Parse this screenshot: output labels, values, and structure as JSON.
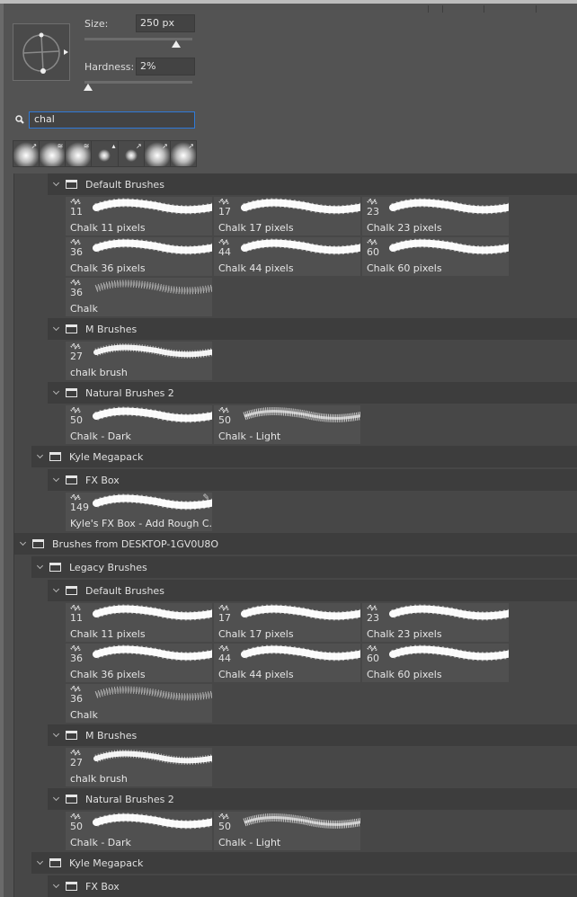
{
  "brush_settings": {
    "size_label": "Size:",
    "size_value": "250 px",
    "size_fraction": 0.85,
    "hardness_label": "Hardness:",
    "hardness_value": "2%",
    "hardness_fraction": 0.02
  },
  "search": {
    "value": "chal",
    "icon": "search-icon"
  },
  "recent_brushes": [
    {
      "type": "soft-round",
      "badge": "brush"
    },
    {
      "type": "soft-round",
      "badge": "airbrush"
    },
    {
      "type": "soft-round",
      "badge": "airbrush"
    },
    {
      "type": "small-round",
      "badge": "drop"
    },
    {
      "type": "small-round",
      "badge": "pen"
    },
    {
      "type": "soft-round",
      "badge": "brush"
    },
    {
      "type": "soft-round",
      "badge": "brush"
    }
  ],
  "colors": {
    "panel": "#535353",
    "list": "#474747",
    "header": "#3d3d3d",
    "tile": "#505050",
    "search_focus": "#2f7ad8"
  },
  "tree": [
    {
      "label": "Default Brushes",
      "level": 2,
      "rows": [
        [
          {
            "size": "11",
            "name": "Chalk 11 pixels",
            "style": "solid"
          },
          {
            "size": "17",
            "name": "Chalk 17 pixels",
            "style": "solid"
          },
          {
            "size": "23",
            "name": "Chalk 23 pixels",
            "style": "solid"
          }
        ],
        [
          {
            "size": "36",
            "name": "Chalk 36 pixels",
            "style": "solid"
          },
          {
            "size": "44",
            "name": "Chalk 44 pixels",
            "style": "solid"
          },
          {
            "size": "60",
            "name": "Chalk 60 pixels",
            "style": "solid"
          }
        ],
        [
          {
            "size": "36",
            "name": "Chalk",
            "style": "grainy"
          }
        ]
      ]
    },
    {
      "label": "M Brushes",
      "level": 2,
      "rows": [
        [
          {
            "size": "27",
            "name": "chalk brush",
            "style": "rough"
          }
        ]
      ]
    },
    {
      "label": "Natural Brushes 2",
      "level": 2,
      "rows": [
        [
          {
            "size": "50",
            "name": "Chalk - Dark",
            "style": "solid"
          },
          {
            "size": "50",
            "name": "Chalk - Light",
            "style": "light"
          }
        ]
      ]
    },
    {
      "label": "Kyle Megapack",
      "level": 1,
      "rows": []
    },
    {
      "label": "FX Box",
      "level": 2,
      "rows": [
        [
          {
            "size": "149",
            "name": "Kyle's FX Box - Add Rough C...",
            "style": "solid",
            "editable": true
          }
        ]
      ]
    },
    {
      "label": "Brushes from DESKTOP-1GV0U8O",
      "level": 0,
      "rows": []
    },
    {
      "label": "Legacy Brushes",
      "level": 1,
      "rows": []
    },
    {
      "label": "Default Brushes",
      "level": 2,
      "rows": [
        [
          {
            "size": "11",
            "name": "Chalk 11 pixels",
            "style": "solid"
          },
          {
            "size": "17",
            "name": "Chalk 17 pixels",
            "style": "solid"
          },
          {
            "size": "23",
            "name": "Chalk 23 pixels",
            "style": "solid"
          }
        ],
        [
          {
            "size": "36",
            "name": "Chalk 36 pixels",
            "style": "solid"
          },
          {
            "size": "44",
            "name": "Chalk 44 pixels",
            "style": "solid"
          },
          {
            "size": "60",
            "name": "Chalk 60 pixels",
            "style": "solid"
          }
        ],
        [
          {
            "size": "36",
            "name": "Chalk",
            "style": "grainy"
          }
        ]
      ]
    },
    {
      "label": "M Brushes",
      "level": 2,
      "rows": [
        [
          {
            "size": "27",
            "name": "chalk brush",
            "style": "rough"
          }
        ]
      ]
    },
    {
      "label": "Natural Brushes 2",
      "level": 2,
      "rows": [
        [
          {
            "size": "50",
            "name": "Chalk - Dark",
            "style": "solid"
          },
          {
            "size": "50",
            "name": "Chalk - Light",
            "style": "light"
          }
        ]
      ]
    },
    {
      "label": "Kyle Megapack",
      "level": 1,
      "rows": []
    },
    {
      "label": "FX Box",
      "level": 2,
      "rows": []
    }
  ]
}
